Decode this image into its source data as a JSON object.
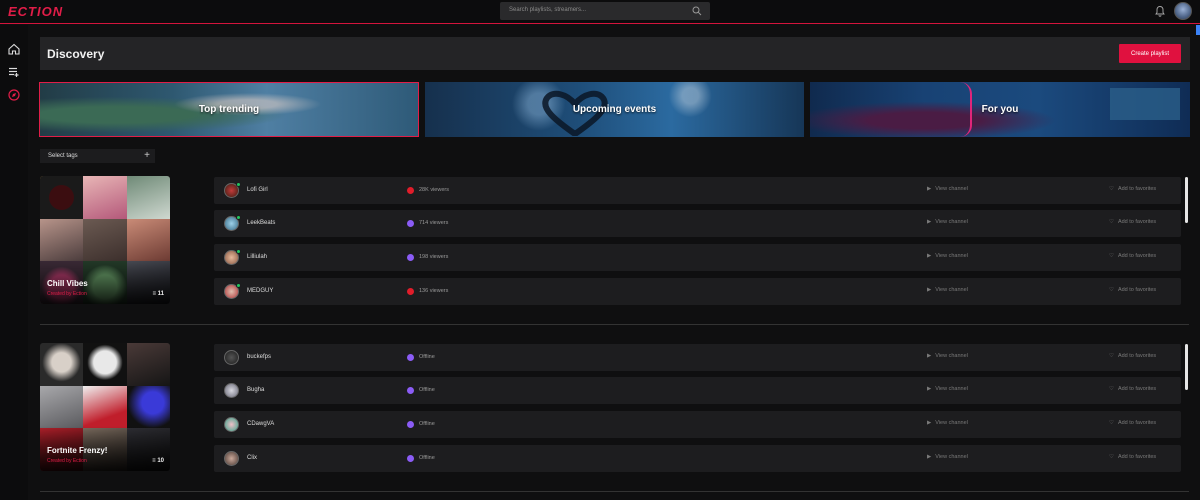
{
  "app": {
    "logo": "ECTION"
  },
  "search": {
    "placeholder": "Search playlists, streamers..."
  },
  "header": {
    "title": "Discovery",
    "create_label": "Create playlist"
  },
  "banners": [
    {
      "label": "Top trending"
    },
    {
      "label": "Upcoming events"
    },
    {
      "label": "For you"
    }
  ],
  "tags": {
    "label": "Select tags",
    "plus": "+"
  },
  "actions": {
    "view": "View channel",
    "fav": "Add to favorites"
  },
  "playlists": [
    {
      "name": "Chill Vibes",
      "created_by": "Created by Ection",
      "count": "11",
      "channels": [
        {
          "name": "Lofi Girl",
          "platform": "youtube",
          "viewers": "28K viewers",
          "online": true
        },
        {
          "name": "LeekBeats",
          "platform": "twitch",
          "viewers": "714 viewers",
          "online": true
        },
        {
          "name": "Lilliulah",
          "platform": "twitch",
          "viewers": "198 viewers",
          "online": true
        },
        {
          "name": "MEDGUY",
          "platform": "youtube",
          "viewers": "136 viewers",
          "online": true
        }
      ]
    },
    {
      "name": "Fortnite Frenzy!",
      "created_by": "Created by Ection",
      "count": "10",
      "channels": [
        {
          "name": "buckefps",
          "platform": "twitch",
          "viewers": "Offline",
          "online": false
        },
        {
          "name": "Bugha",
          "platform": "twitch",
          "viewers": "Offline",
          "online": false
        },
        {
          "name": "CDawgVA",
          "platform": "twitch",
          "viewers": "Offline",
          "online": false
        },
        {
          "name": "Clix",
          "platform": "twitch",
          "viewers": "Offline",
          "online": false
        }
      ]
    }
  ],
  "colors": {
    "accent": "#e11d48",
    "youtube": "#e11d2a",
    "twitch": "#8b5cf6",
    "online": "#22c55e"
  },
  "icons": {
    "home": "home-icon",
    "playlist": "playlist-add-icon",
    "discover": "compass-icon",
    "bell": "bell-icon",
    "search": "search-icon",
    "play": "play-icon",
    "heart": "heart-icon"
  }
}
